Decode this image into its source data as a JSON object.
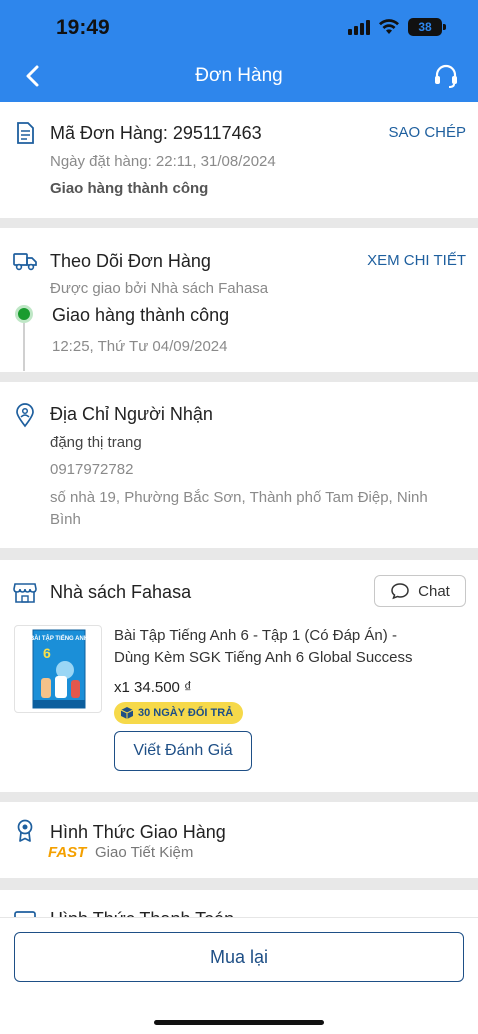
{
  "status_bar": {
    "time": "19:49",
    "battery": "38"
  },
  "nav": {
    "title": "Đơn Hàng"
  },
  "order": {
    "code_label": "Mã Đơn Hàng: 295117463",
    "copy_label": "SAO CHÉP",
    "date": "Ngày đặt hàng: 22:11, 31/08/2024",
    "status": "Giao hàng thành công"
  },
  "tracking": {
    "title": "Theo Dõi Đơn Hàng",
    "detail_label": "XEM CHI TIẾT",
    "delivered_by": "Được giao bởi Nhà sách Fahasa",
    "event_status": "Giao hàng thành công",
    "event_time": "12:25, Thứ Tư 04/09/2024"
  },
  "recipient": {
    "title": "Địa Chỉ Người Nhận",
    "name": "đặng thị trang",
    "phone": "0917972782",
    "address_line1": "số nhà 19, Phường Bắc Sơn, Thành phố Tam Điệp, Ninh",
    "address_line2": "Bình"
  },
  "store": {
    "name": "Nhà sách Fahasa",
    "chat_label": "Chat",
    "product": {
      "name_line1": "Bài Tập Tiếng Anh 6 - Tập 1 (Có Đáp Án) -",
      "name_line2": "Dùng Kèm SGK Tiếng Anh 6 Global Success",
      "qty_price": "x1  34.500 ₫",
      "badge": "30 NGÀY ĐỔI TRẢ",
      "cover_title": "BÀI TẬP TIẾNG ANH",
      "cover_number": "6"
    },
    "review_label": "Viết Đánh Giá"
  },
  "shipping": {
    "title": "Hình Thức Giao Hàng",
    "fast_tag": "FAST",
    "method": "Giao Tiết Kiệm"
  },
  "payment": {
    "title": "Hình Thức Thanh Toán"
  },
  "footer": {
    "rebuy_label": "Mua lại"
  },
  "colors": {
    "header": "#2e86ec",
    "link": "#1e5f9e",
    "success": "#1a9c2f",
    "badge": "#f6d94a",
    "fast": "#f4a000"
  }
}
